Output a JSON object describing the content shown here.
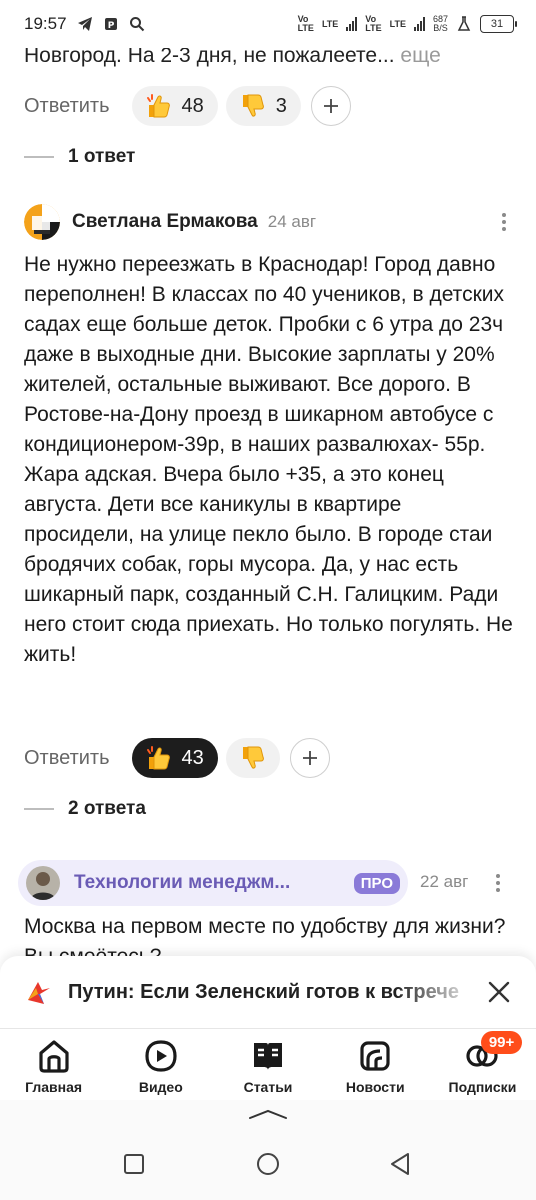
{
  "status_bar": {
    "time": "19:57",
    "lte1": "Vo",
    "lte1b": "LTE",
    "lte2": "LTE",
    "lte3": "Vo",
    "lte3b": "LTE",
    "lte4": "LTE",
    "speed_value": "687",
    "speed_unit": "B/S",
    "battery": "31"
  },
  "prev_comment": {
    "truncated_text": "Новгород. На 2-3 дня, не пожалеете... ",
    "more_label": "еще",
    "reply_label": "Ответить",
    "likes": "48",
    "dislikes": "3",
    "replies_label": "1 ответ"
  },
  "comment": {
    "author": "Светлана Ермакова",
    "date": "24 авг",
    "text": "Не нужно переезжать в Краснодар! Город давно переполнен! В классах по 40 учеников, в детских садах еще больше деток. Пробки с 6 утра до 23ч даже в выходные дни. Высокие зарплаты у 20% жителей, остальные выживают. Все дорого. В Ростове-на-Дону проезд в шикарном автобусе с кондиционером-39р, в наших развалюхах- 55р. Жара адская. Вчера было +35, а это конец августа. Дети все каникулы в квартире просидели, на улице пекло было. В городе стаи бродячих собак, горы мусора. Да, у нас есть шикарный парк, созданный С.Н. Галицким. Ради него стоит сюда приехать. Но только погулять. Не жить!",
    "reply_label": "Ответить",
    "likes": "43",
    "replies_label": "2 ответа"
  },
  "next_comment": {
    "channel_name": "Технологии менеджм...",
    "pro_label": "ПРО",
    "date": "22 авг",
    "text": "Москва на первом месте по удобству для жизни? Вы смеётесь?"
  },
  "news_banner": {
    "text": "Путин: Если Зеленский готов к встрече"
  },
  "tabs": [
    {
      "label": "Главная",
      "icon": "home-icon"
    },
    {
      "label": "Видео",
      "icon": "video-icon"
    },
    {
      "label": "Статьи",
      "icon": "articles-icon"
    },
    {
      "label": "Новости",
      "icon": "news-icon"
    },
    {
      "label": "Подписки",
      "icon": "subscriptions-icon",
      "badge": "99+"
    }
  ],
  "colors": {
    "accent_purple": "#6a5bb5",
    "pro_badge": "#8a7ad8",
    "badge_orange": "#ff4d1a"
  }
}
